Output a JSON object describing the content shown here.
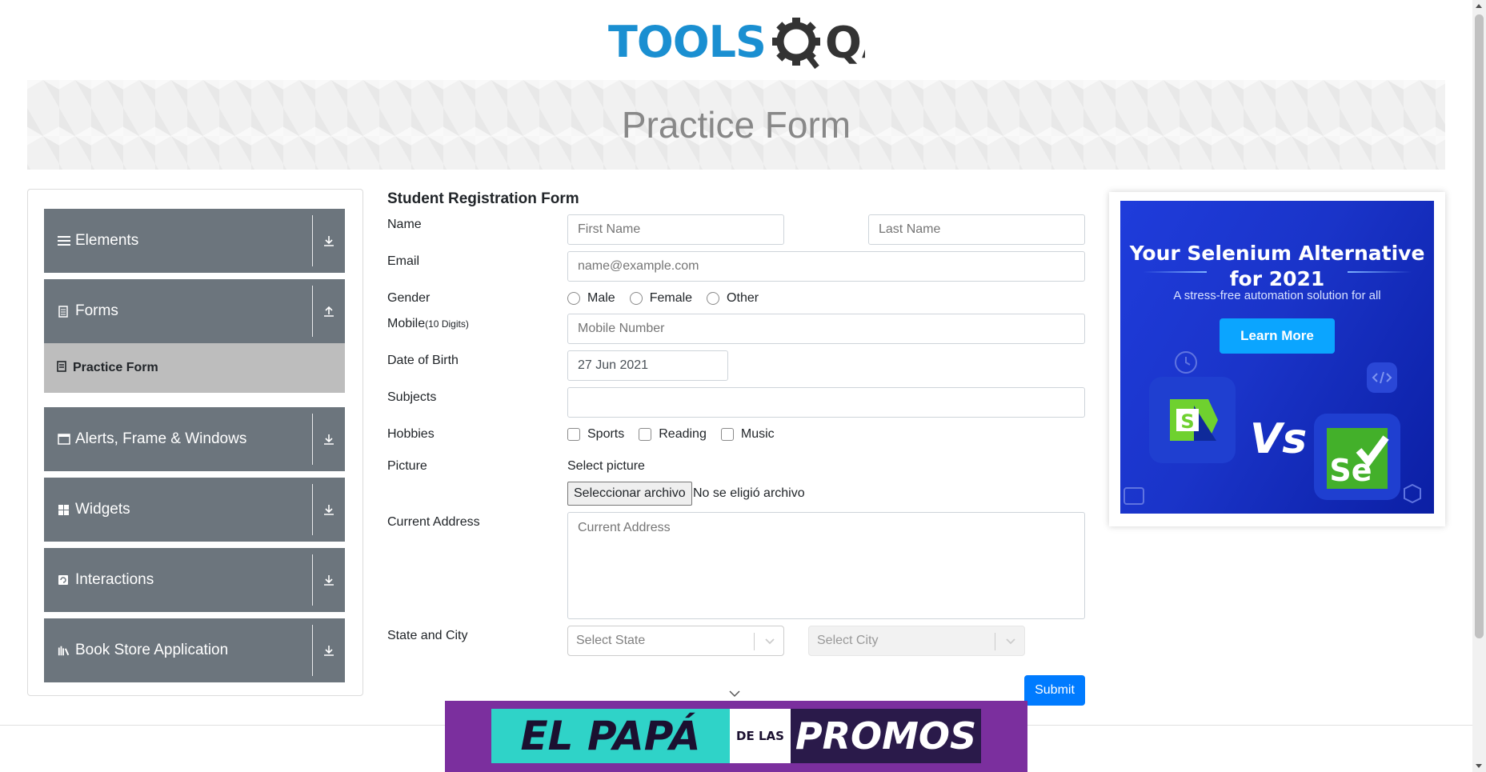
{
  "logo": {
    "text_left": "TOOLS",
    "text_right": "QA"
  },
  "banner": {
    "title": "Practice Form"
  },
  "sidebar": {
    "groups": [
      {
        "label": "Elements",
        "icon": "menu-icon"
      },
      {
        "label": "Forms",
        "icon": "document-icon",
        "expanded": true
      },
      {
        "label": "Alerts, Frame & Windows",
        "icon": "window-icon"
      },
      {
        "label": "Widgets",
        "icon": "widgets-icon"
      },
      {
        "label": "Interactions",
        "icon": "interactions-icon"
      },
      {
        "label": "Book Store Application",
        "icon": "books-icon"
      }
    ],
    "forms_subitems": [
      {
        "label": "Practice Form",
        "active": true
      }
    ]
  },
  "form": {
    "title": "Student Registration Form",
    "labels": {
      "name": "Name",
      "email": "Email",
      "gender": "Gender",
      "mobile": "Mobile",
      "mobile_hint": "(10 Digits)",
      "dob": "Date of Birth",
      "subjects": "Subjects",
      "hobbies": "Hobbies",
      "picture": "Picture",
      "current_address": "Current Address",
      "state_city": "State and City"
    },
    "placeholders": {
      "first_name": "First Name",
      "last_name": "Last Name",
      "email": "name@example.com",
      "mobile": "Mobile Number",
      "current_address": "Current Address"
    },
    "values": {
      "dob": "27 Jun 2021",
      "subjects": ""
    },
    "gender_options": [
      "Male",
      "Female",
      "Other"
    ],
    "hobby_options": [
      "Sports",
      "Reading",
      "Music"
    ],
    "picture": {
      "caption": "Select picture",
      "button": "Seleccionar archivo",
      "status": "No se eligió archivo"
    },
    "state_placeholder": "Select State",
    "city_placeholder": "Select City",
    "submit_label": "Submit"
  },
  "ad": {
    "title_line1": "Your Selenium Alternative",
    "title_line2": "for 2021",
    "subtitle": "A stress-free automation solution for all",
    "button": "Learn More",
    "vs": "Vs",
    "logo_left": "S",
    "logo_right": "Se"
  },
  "promo": {
    "part1": "EL PAPÁ",
    "part2": "DE LAS",
    "part3": "PROMOS"
  },
  "colors": {
    "menu_bg": "#6c757d",
    "active_bg": "#bdbdbd",
    "primary": "#007bff",
    "logo_blue": "#1a8fd1"
  }
}
